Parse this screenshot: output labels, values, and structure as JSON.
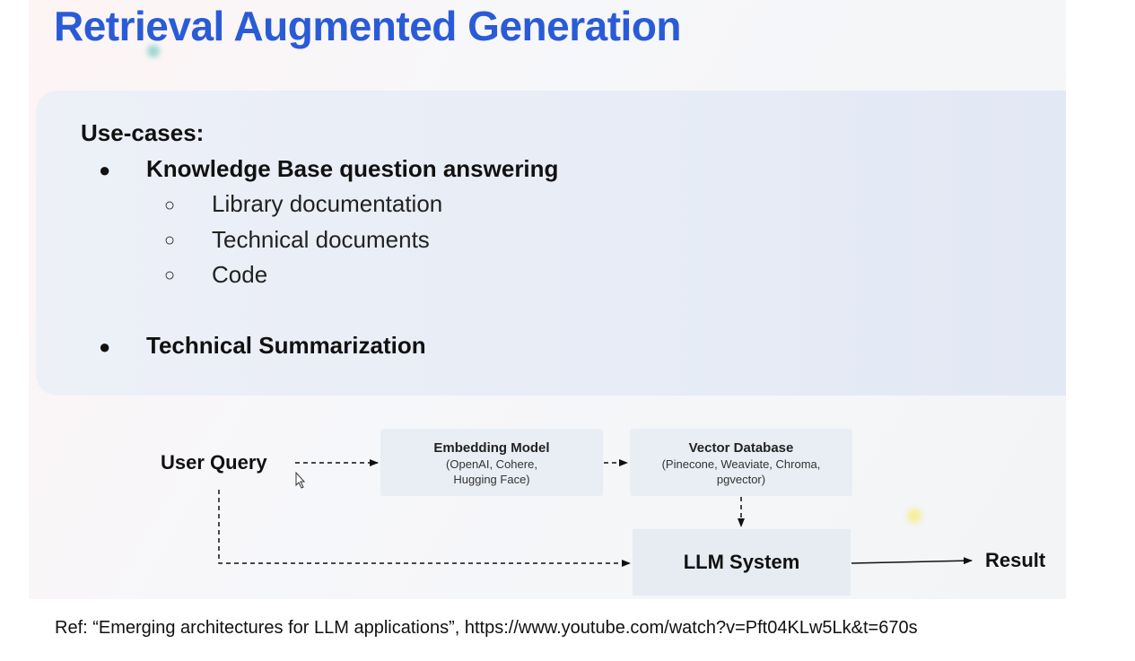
{
  "slide": {
    "title": "Retrieval Augmented Generation",
    "usecases_heading": "Use-cases:",
    "bullet_glyph": "●",
    "sub_bullet_glyph": "○",
    "items": [
      {
        "label": "Knowledge Base question answering",
        "subitems": [
          "Library documentation",
          "Technical documents",
          "Code"
        ]
      },
      {
        "label": "Technical Summarization"
      }
    ]
  },
  "diagram": {
    "user_query": "User Query",
    "embedding_model": {
      "title": "Embedding Model",
      "line1": "(OpenAI, Cohere,",
      "line2": "Hugging Face)"
    },
    "vector_database": {
      "title": "Vector Database",
      "line1": "(Pinecone, Weaviate, Chroma,",
      "line2": "pgvector)"
    },
    "llm_system": "LLM System",
    "result": "Result"
  },
  "reference": "Ref: “Emerging architectures for LLM applications”, https://www.youtube.com/watch?v=Pft04KLw5Lk&t=670s",
  "colors": {
    "title": "#2a5bd7",
    "panel": "#e9edf6",
    "box": "#e9eef4",
    "text": "#111111"
  }
}
